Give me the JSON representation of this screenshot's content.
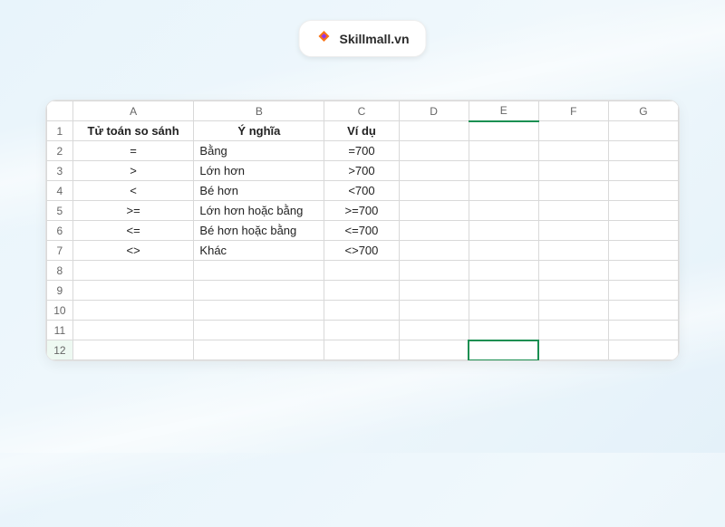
{
  "brand": {
    "name": "Skillmall.vn"
  },
  "columns": [
    "A",
    "B",
    "C",
    "D",
    "E",
    "F",
    "G"
  ],
  "rowNumbers": [
    1,
    2,
    3,
    4,
    5,
    6,
    7,
    8,
    9,
    10,
    11,
    12
  ],
  "header_row": {
    "A": "Tử toán so sánh",
    "B": "Ý nghĩa",
    "C": "Ví dụ"
  },
  "rows": [
    {
      "op": "=",
      "meaning": "Bằng",
      "example": "=700"
    },
    {
      "op": ">",
      "meaning": "Lớn hơn",
      "example": ">700"
    },
    {
      "op": "<",
      "meaning": "Bé hơn",
      "example": "<700"
    },
    {
      "op": ">=",
      "meaning": "Lớn hơn hoặc bằng",
      "example": ">=700"
    },
    {
      "op": "<=",
      "meaning": "Bé hơn hoặc bằng",
      "example": "<=700"
    },
    {
      "op": "<>",
      "meaning": "Khác",
      "example": "<>700"
    }
  ],
  "active_cell": {
    "col": "E",
    "row": 12
  }
}
